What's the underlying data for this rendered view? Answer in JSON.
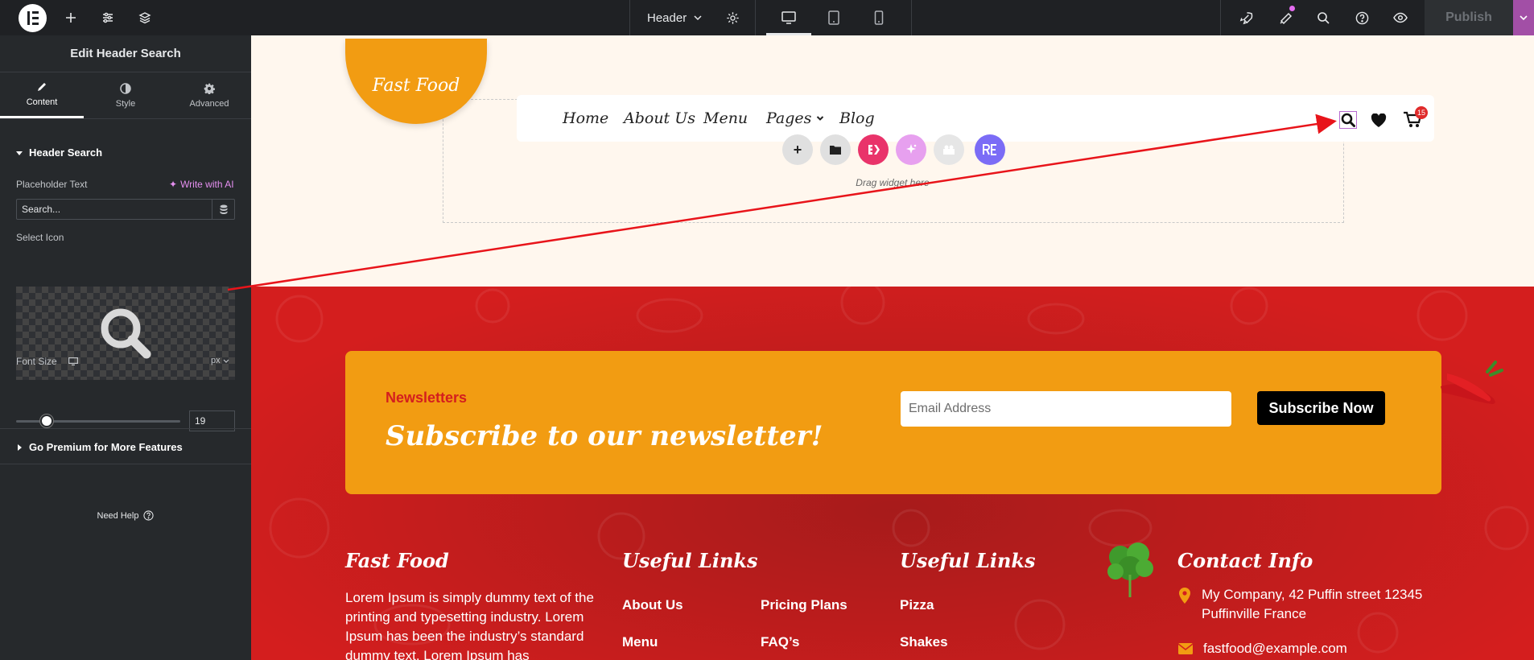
{
  "topbar": {
    "document_name": "Header",
    "publish_label": "Publish"
  },
  "panel": {
    "title": "Edit Header Search",
    "tabs": [
      {
        "label": "Content"
      },
      {
        "label": "Style"
      },
      {
        "label": "Advanced"
      }
    ],
    "section_title": "Header Search",
    "placeholder_label": "Placeholder Text",
    "write_ai_label": "Write with AI",
    "placeholder_value": "Search...",
    "select_icon_label": "Select Icon",
    "font_size_label": "Font Size",
    "font_size_unit": "px",
    "font_size_value": "19",
    "premium_label": "Go Premium for More Features",
    "help_label": "Need Help"
  },
  "page": {
    "logo_text": "Fast Food",
    "nav": [
      {
        "label": "Home"
      },
      {
        "label": "About Us"
      },
      {
        "label": "Menu"
      },
      {
        "label": "Pages"
      },
      {
        "label": "Blog"
      }
    ],
    "cart_count": "15",
    "drag_hint": "Drag widget here",
    "newsletter": {
      "kicker": "Newsletters",
      "heading": "Subscribe to our newsletter!",
      "email_placeholder": "Email Address",
      "button": "Subscribe Now"
    },
    "footer": {
      "brand_title": "Fast Food",
      "brand_text": "Lorem Ipsum is simply dummy text of the printing and typesetting industry. Lorem Ipsum has been the industry’s standard dummy text. Lorem Ipsum has",
      "useful_links_title_1": "Useful Links",
      "useful_links_title_2": "Useful Links",
      "col2_links": [
        "About Us",
        "Menu"
      ],
      "col3_links": [
        "Pricing Plans",
        "FAQ’s"
      ],
      "col4_links": [
        "Pizza",
        "Shakes"
      ],
      "contact_title": "Contact Info",
      "address": "My Company, 42 Puffin street 12345 Puffinville France",
      "email": "fastfood@example.com"
    }
  },
  "colors": {
    "accent_orange": "#f29c12",
    "footer_red": "#d41e1e",
    "editor_dark": "#26292c",
    "arrow_red": "#e8141a"
  }
}
